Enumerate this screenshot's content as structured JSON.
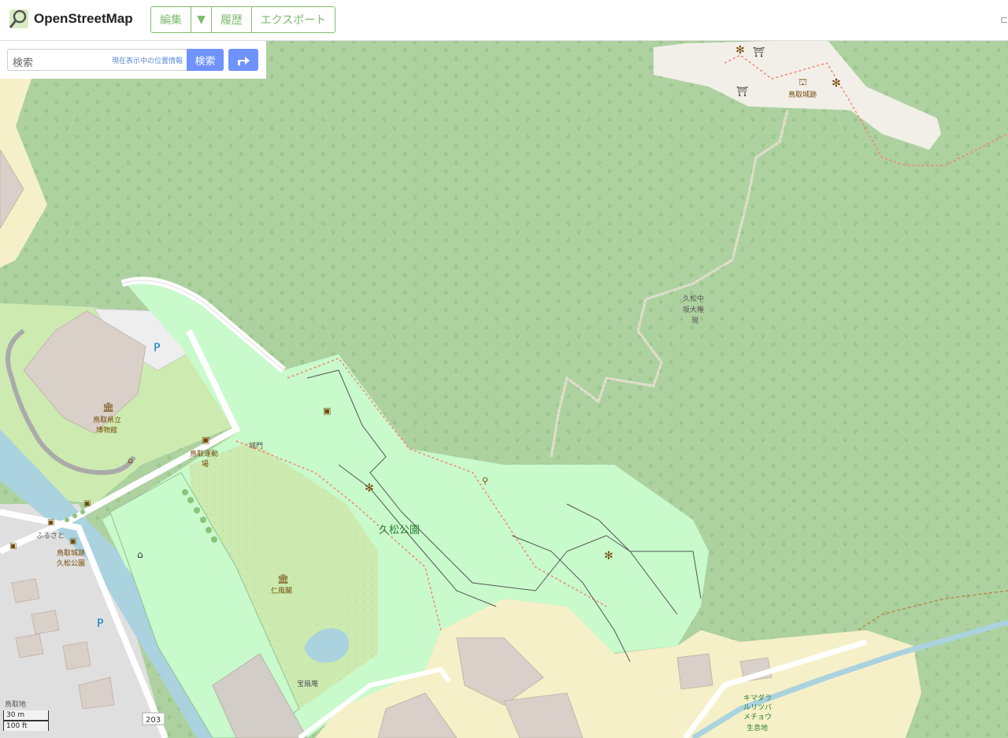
{
  "header": {
    "brand": "OpenStreetMap",
    "edit_label": "編集",
    "caret": "▼",
    "history_label": "履歴",
    "export_label": "エクスポート"
  },
  "search": {
    "placeholder": "検索",
    "where_link": "現在表示中の位置情報",
    "button": "検索"
  },
  "map": {
    "labels": {
      "castle_ruins_top": "鳥取城跡",
      "park": "久松公園",
      "shrine_1": "久松中",
      "shrine_2": "坂大権",
      "shrine_3": "現",
      "museum_1": "鳥取県立",
      "museum_2": "博物館",
      "sports_1": "鳥取運動",
      "sports_2": "場",
      "gate": "城門",
      "bus_furusato": "ふるさと",
      "bus_castle_1": "鳥取城跡",
      "bus_castle_2": "久松公園",
      "jinpukaku": "仁風閣",
      "hosenan": "宝扇庵",
      "parking": "P",
      "district": "鳥取地",
      "route": "203",
      "kimadara_1": "キマダラ",
      "kimadara_2": "ルリツバ",
      "kimadara_3": "メチョウ",
      "kimadara_4": "生息地"
    }
  },
  "scale": {
    "metric": "30 m",
    "imperial": "100 ft"
  },
  "colors": {
    "forest": "#aed1a0",
    "park": "#c8facc",
    "residential": "#e0dfdf",
    "commercial": "#f2efe9",
    "building": "#d9d0c9",
    "water": "#aad3df",
    "footpath": "#fa8072",
    "accent": "#7ebc6f",
    "search_button": "#7092ff"
  }
}
